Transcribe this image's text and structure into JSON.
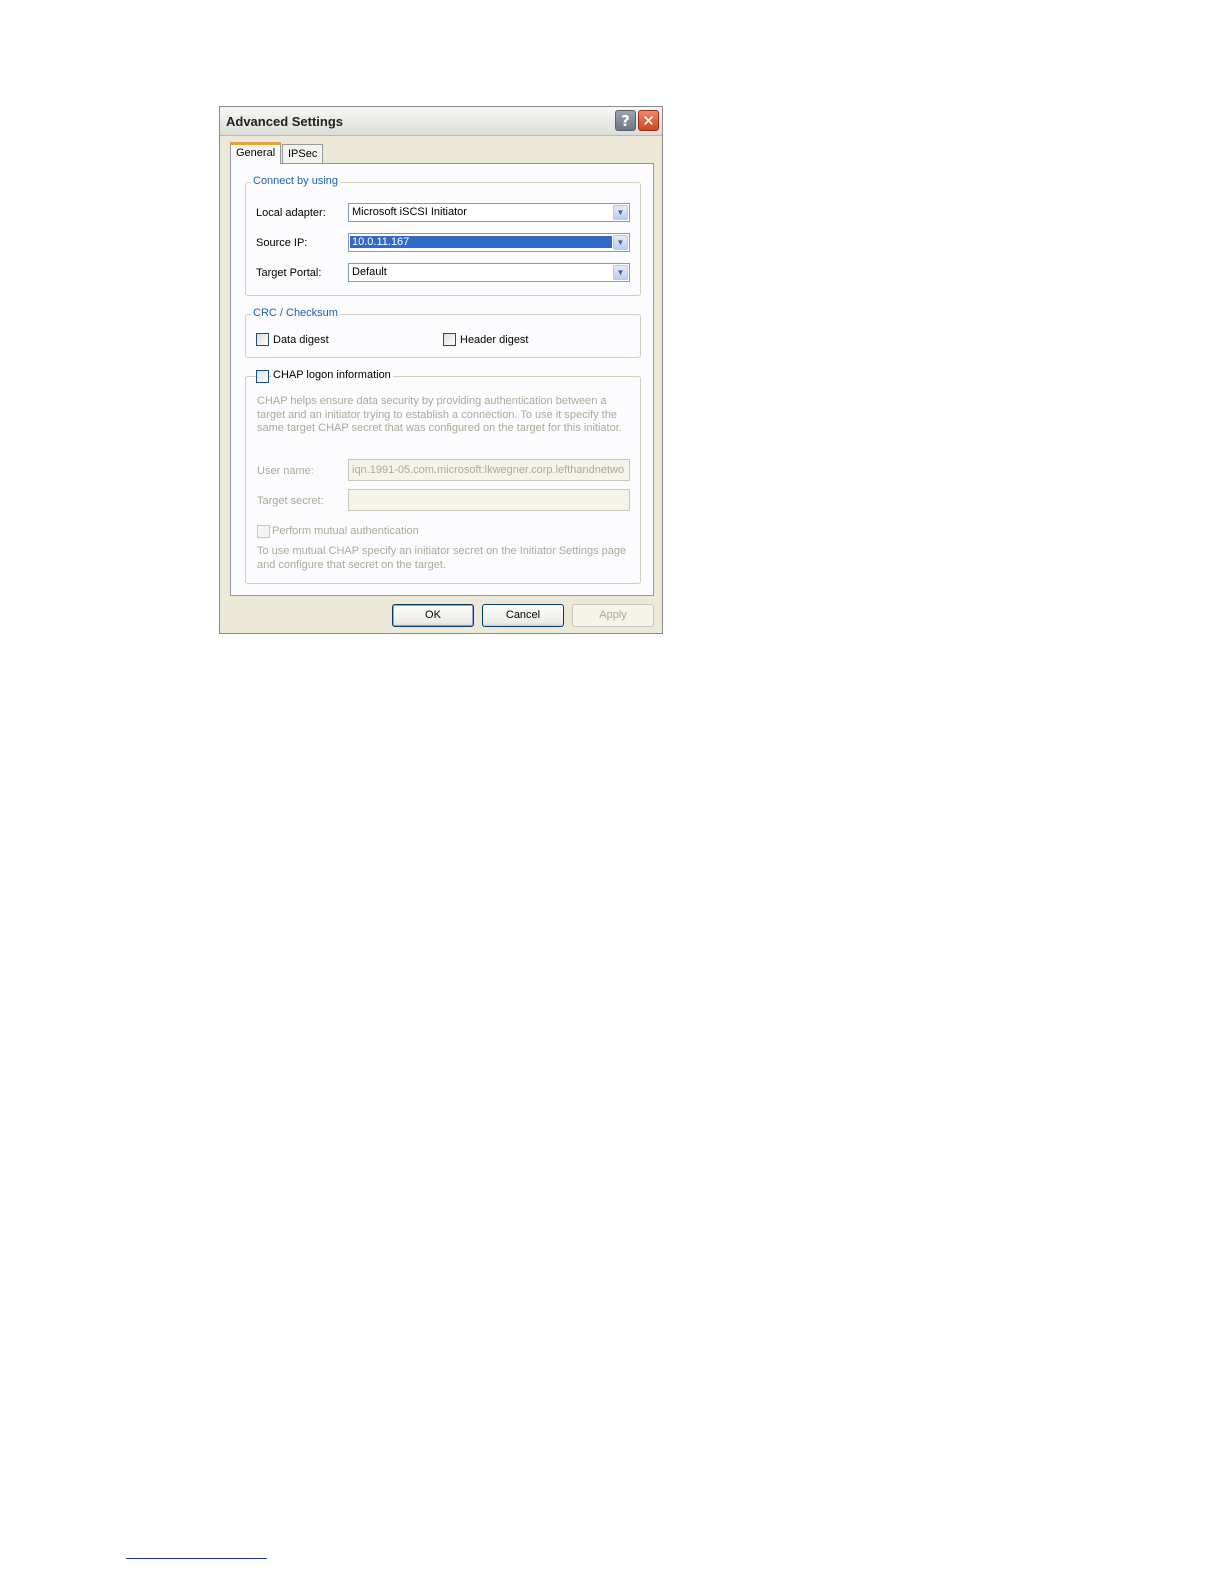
{
  "window": {
    "title": "Advanced Settings",
    "help_icon": "question-mark",
    "close_icon": "x-mark"
  },
  "tabs": [
    {
      "label": "General",
      "active": true
    },
    {
      "label": "IPSec",
      "active": false
    }
  ],
  "connect": {
    "legend": "Connect by using",
    "local_adapter_label": "Local adapter:",
    "local_adapter_value": "Microsoft iSCSI Initiator",
    "source_ip_label": "Source IP:",
    "source_ip_value": "10.0.11.167",
    "target_portal_label": "Target Portal:",
    "target_portal_value": "Default"
  },
  "crc": {
    "legend": "CRC / Checksum",
    "data_digest_label": "Data digest",
    "data_digest_checked": false,
    "header_digest_label": "Header digest",
    "header_digest_checked": false
  },
  "chap": {
    "checkbox_label": "CHAP logon information",
    "checked": false,
    "description": "CHAP helps ensure data security by providing authentication between a target and an initiator trying to establish a connection. To use it specify the same target CHAP secret that was configured on the target for this initiator.",
    "user_name_label": "User name:",
    "user_name_value": "iqn.1991-05.com.microsoft:lkwegner.corp.lefthandnetwo",
    "target_secret_label": "Target secret:",
    "target_secret_value": "",
    "mutual_auth_label": "Perform mutual authentication",
    "mutual_auth_note": "To use mutual CHAP specify an initiator secret on the Initiator Settings page and configure that secret on the target."
  },
  "buttons": {
    "ok": "OK",
    "cancel": "Cancel",
    "apply": "Apply"
  }
}
